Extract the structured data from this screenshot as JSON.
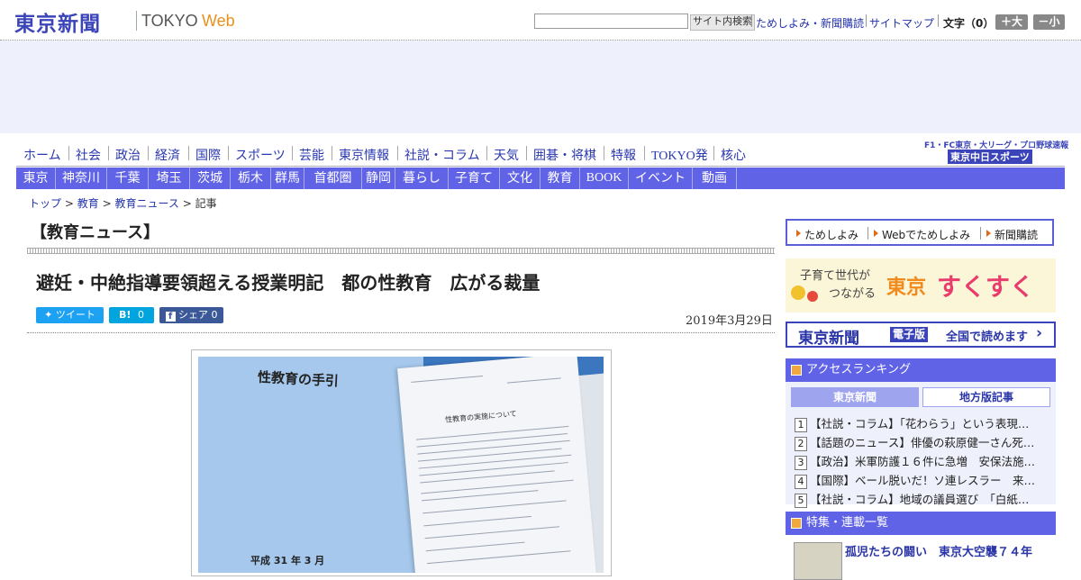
{
  "header": {
    "logo_jp": "東京新聞",
    "logo_en_1": "TOKYO",
    "logo_en_2": "Web",
    "search_button": "サイト内検索",
    "links": [
      "ためしよみ・新聞購読",
      "サイトマップ"
    ],
    "font_size_label": "文字（0）",
    "font_larger": "＋大",
    "font_smaller": "－小"
  },
  "nav_primary": [
    "ホーム",
    "社会",
    "政治",
    "経済",
    "国際",
    "スポーツ",
    "芸能",
    "東京情報",
    "社説・コラム",
    "天気",
    "囲碁・将棋",
    "特報",
    "TOKYO発",
    "核心"
  ],
  "chunichi_sports": {
    "line1": "F1・FC東京・大リーグ・プロ野球速報",
    "line2": "東京中日スポーツ"
  },
  "nav_regional": [
    "東京",
    "神奈川",
    "千葉",
    "埼玉",
    "茨城",
    "栃木",
    "群馬",
    "首都圏",
    "静岡",
    "暮らし",
    "子育て",
    "文化",
    "教育",
    "BOOK",
    "イベント",
    "動画"
  ],
  "breadcrumb": {
    "items": [
      "トップ",
      "教育",
      "教育ニュース"
    ],
    "current": "記事",
    "separator": ">"
  },
  "article": {
    "section": "【教育ニュース】",
    "headline": "避妊・中絶指導要領超える授業明記　都の性教育　広がる裁量",
    "date": "2019年3月29日",
    "share": {
      "tweet": "ツイート",
      "hatena_icon": "B!",
      "hatena_count": "0",
      "facebook_label": "シェア",
      "facebook_count": "0"
    },
    "photo": {
      "booklet_title": "性教育の手引",
      "booklet_date": "平成 31 年 3 月",
      "doc_title": "性教育の実施について"
    }
  },
  "sidebar": {
    "trial_links": [
      "ためしよみ",
      "Webでためしよみ",
      "新聞購読"
    ],
    "sukusuku": {
      "tagline1": "子育て世代が",
      "tagline2": "つながる",
      "brand1": "東京",
      "brand2": "すくすく"
    },
    "ebook": {
      "logo": "東京新聞",
      "tag": "電子版",
      "text": "全国で読めます",
      "chevron": "›"
    },
    "ranking": {
      "title": "アクセスランキング",
      "tab_tokyo": "東京新聞",
      "tab_local": "地方版記事",
      "items": [
        {
          "num": "1",
          "text": "【社説・コラム】「花わらう」という表現…"
        },
        {
          "num": "2",
          "text": "【話題のニュース】俳優の萩原健一さん死…"
        },
        {
          "num": "3",
          "text": "【政治】米軍防護１６件に急増　安保法施…"
        },
        {
          "num": "4",
          "text": "【国際】ベール脱いだ！ソ連レスラー　来…"
        },
        {
          "num": "5",
          "text": "【社説・コラム】地域の議員選び　「白紙…"
        }
      ]
    },
    "features": {
      "title": "特集・連載一覧",
      "item_title": "孤児たちの闘い　東京大空襲７４年"
    }
  },
  "colors": {
    "brand_blue": "#3b44b8",
    "nav_purple": "#6063e6",
    "ad_band": "#eef0fb",
    "twitter": "#1da1f2",
    "hatena": "#00a4de",
    "facebook": "#3b5998"
  }
}
